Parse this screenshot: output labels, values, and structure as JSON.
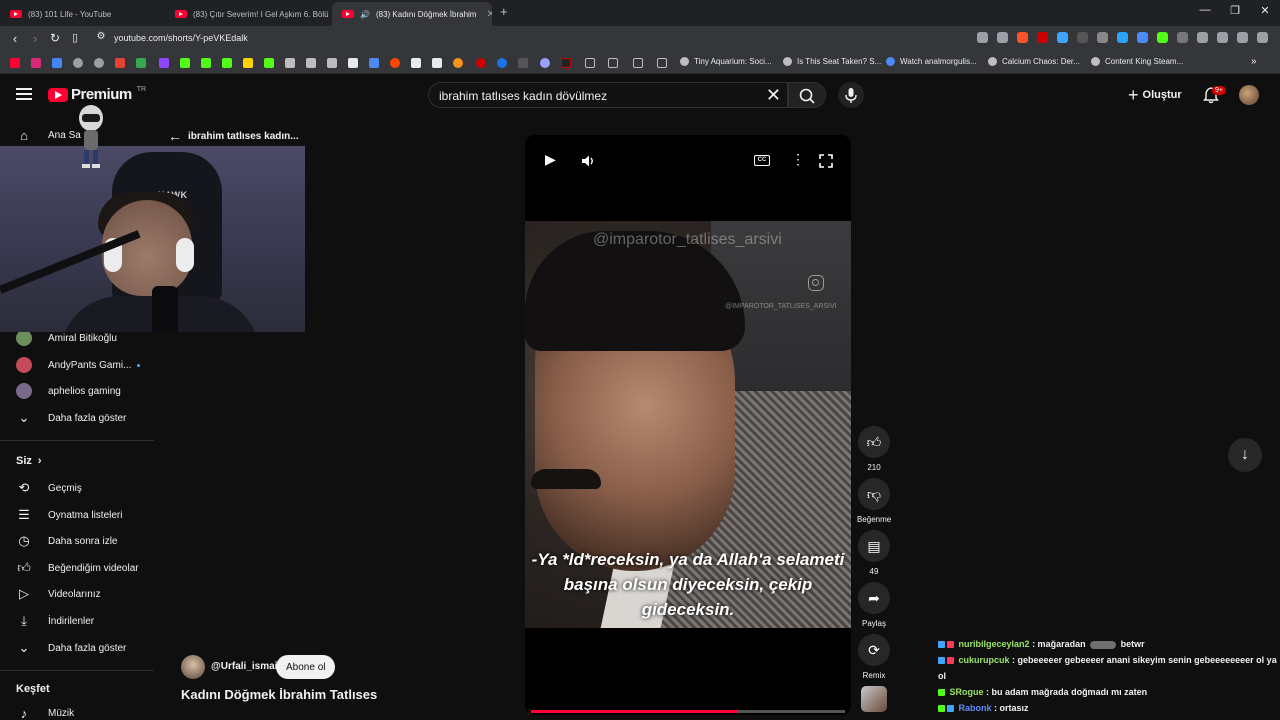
{
  "browser": {
    "tabs": [
      {
        "title": "(83) 101 Life - YouTube",
        "active": false
      },
      {
        "title": "(83) Çıtır Severim! I Gel Aşkım 6. Bölü",
        "active": false
      },
      {
        "title": "(83) Kadını Döğmek İbrahim",
        "active": true
      }
    ],
    "url": "youtube.com/shorts/Y-peVKEdalk",
    "bookmarks": [
      "Tiny Aquarium: Soci...",
      "Is This Seat Taken? S...",
      "Watch analmorgulis...",
      "Calcium Chaos: Der...",
      "Content King Steam..."
    ]
  },
  "header": {
    "logo": "Premium",
    "logo_region": "TR",
    "search_query": "ibrahim tatlıses kadın dövülmez",
    "create_label": "Oluştur",
    "notification_count": "9+"
  },
  "sidebar": {
    "home_label": "Ana Sa",
    "subscriptions": [
      {
        "name": "Amiral Bitikoğlu",
        "color": "#6a8f5a"
      },
      {
        "name": "AndyPants Gami...",
        "color": "#c44a5a",
        "live": true
      },
      {
        "name": "aphelios gaming",
        "color": "#7a6a8a"
      }
    ],
    "show_more_1": "Daha fazla göster",
    "you_heading": "Siz",
    "you_items": [
      {
        "label": "Geçmiş",
        "icon": "history-icon"
      },
      {
        "label": "Oynatma listeleri",
        "icon": "playlist-icon"
      },
      {
        "label": "Daha sonra izle",
        "icon": "clock-icon"
      },
      {
        "label": "Beğendiğim videolar",
        "icon": "like-icon"
      },
      {
        "label": "Videolarınız",
        "icon": "video-icon"
      },
      {
        "label": "İndirilenler",
        "icon": "download-icon"
      }
    ],
    "show_more_2": "Daha fazla göster",
    "explore_heading": "Keşfet",
    "music_label": "Müzik"
  },
  "webcam": {
    "chair_brand": "HAWK"
  },
  "back_link": "ibrahim tatlıses kadın...",
  "player": {
    "watermark_top": "@imparotor_tatlises_arsivi",
    "watermark_small": "@IMPAROTOR_TATLISES_ARSIVI",
    "cc_label": "CC",
    "subtitle_lines": [
      "-Ya *ld*receksin, ya da Allah'a selameti",
      "başına olsun diyeceksin, çekip",
      "gideceksin."
    ],
    "progress": 0.66
  },
  "actions": {
    "like_count": "210",
    "dislike_label": "Beğenme",
    "comment_count": "49",
    "share_label": "Paylaş",
    "remix_label": "Remix"
  },
  "channel": {
    "handle": "@Urfali_ismail",
    "subscribe_label": "Abone ol",
    "video_title": "Kadını Döğmek İbrahim Tatlıses"
  },
  "chat": [
    {
      "user": "nuribilgeceylan2",
      "color": "#9be564",
      "message": ": mağaradan",
      "emote": true,
      "after": "betwr"
    },
    {
      "user": "cukurupcuk",
      "color": "#9be564",
      "message": ": gebeeeeer gebeeeer anani sikeyim senin gebeeeeeeeer ol ya ol"
    },
    {
      "user": "SRogue",
      "color": "#9be564",
      "message": ": bu adam mağrada doğmadı mı zaten"
    },
    {
      "user": "Rabonk",
      "color": "#5b8cff",
      "message": ": ortasız"
    }
  ],
  "colors": {
    "accent": "#ff0033",
    "background": "#0f0f0f",
    "chip": "#272727"
  }
}
